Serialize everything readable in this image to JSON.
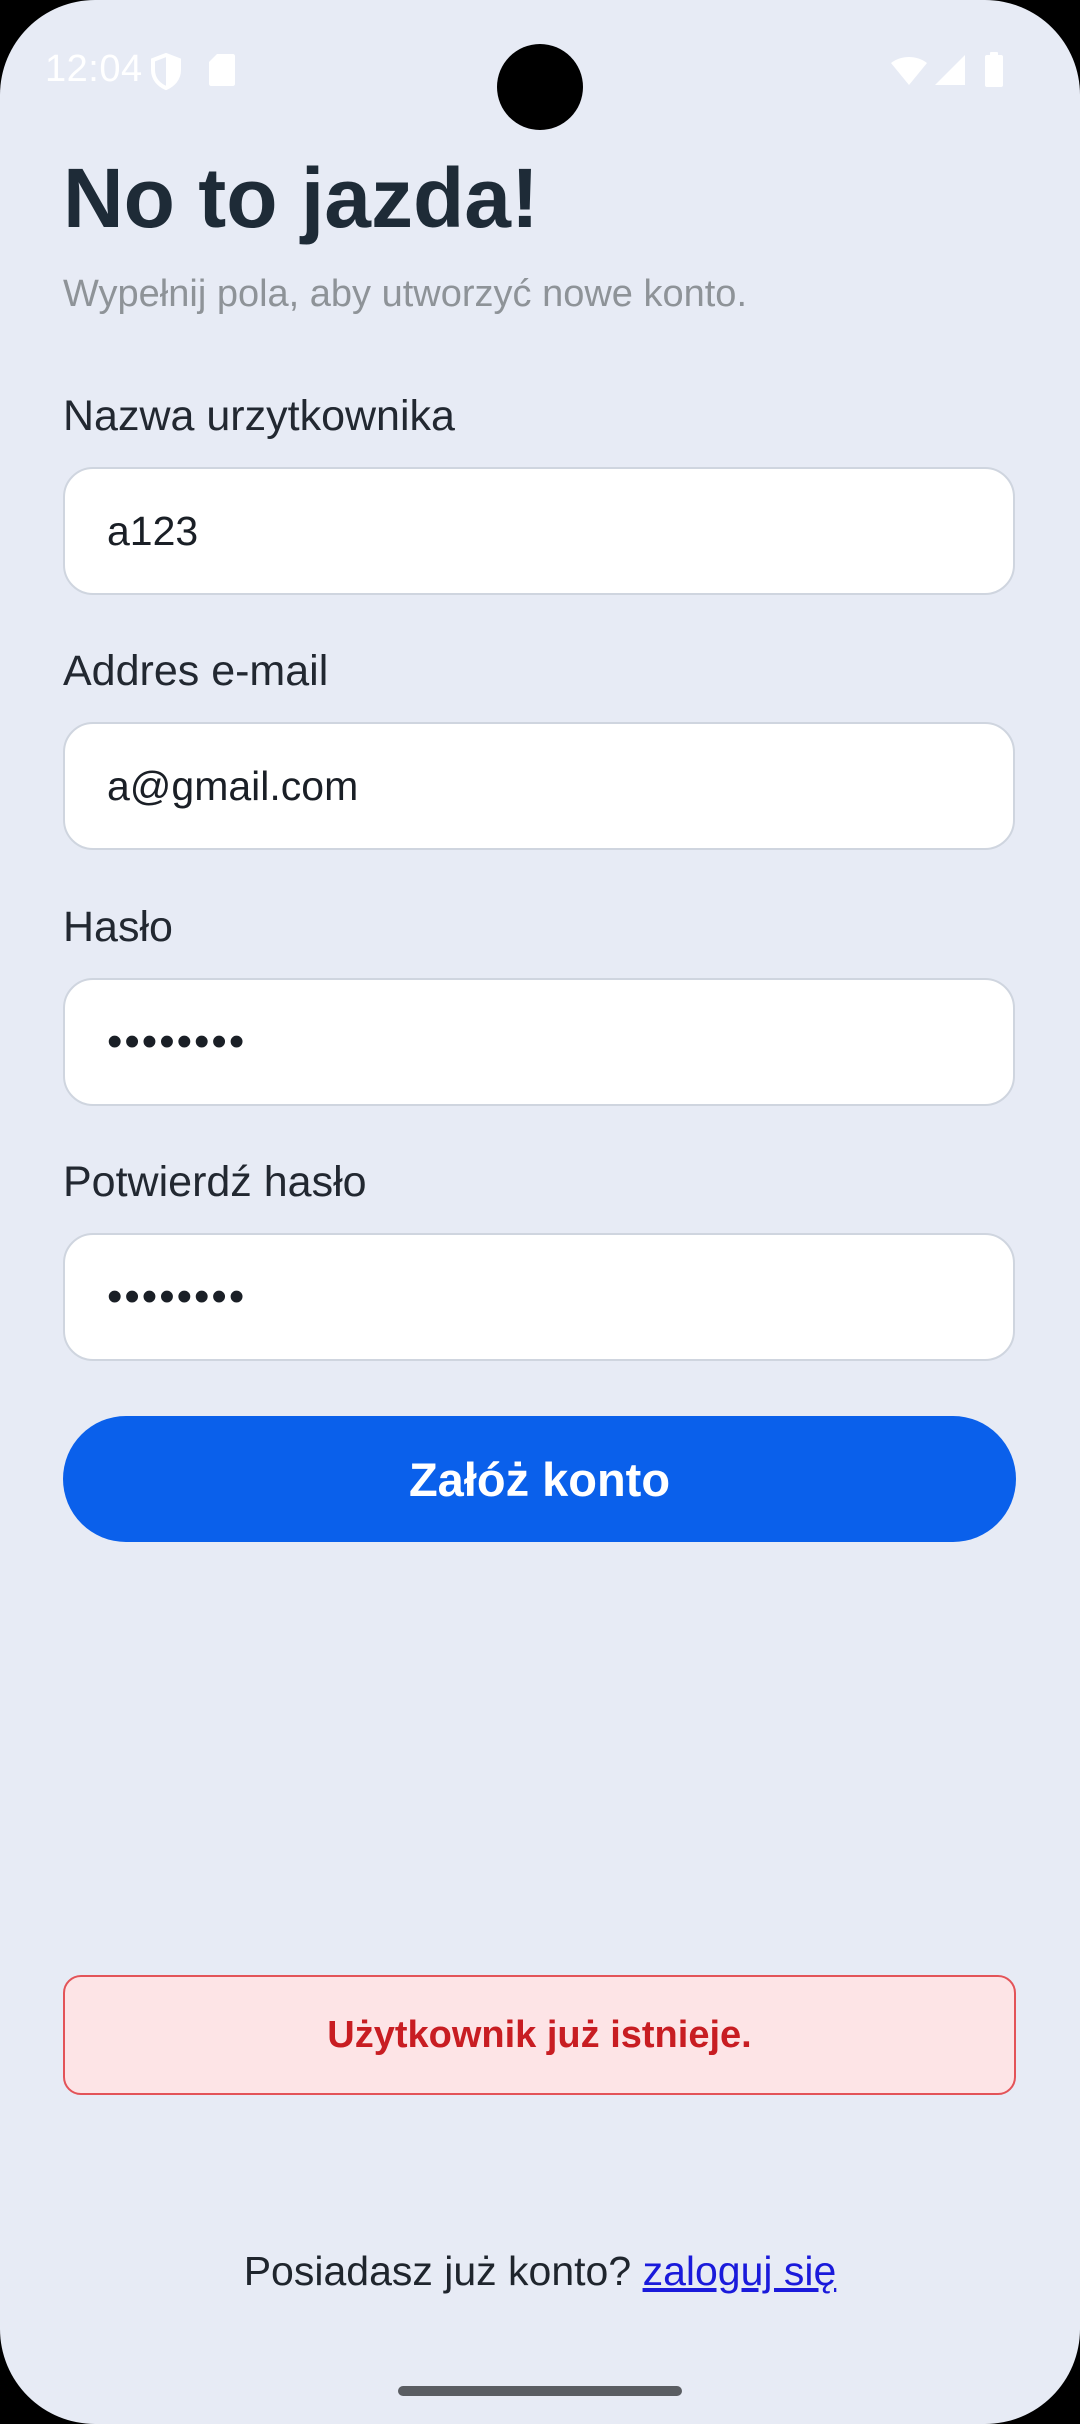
{
  "status_bar": {
    "time": "12:04",
    "icons": [
      "shield-icon",
      "sd-card-icon",
      "wifi-icon",
      "signal-icon",
      "battery-icon"
    ]
  },
  "header": {
    "title": "No to jazda!",
    "subtitle": "Wypełnij pola, aby utworzyć nowe konto."
  },
  "form": {
    "username": {
      "label": "Nazwa urzytkownika",
      "value": "a123"
    },
    "email": {
      "label": "Addres e-mail",
      "value": "a@gmail.com"
    },
    "password": {
      "label": "Hasło",
      "value": "••••••••"
    },
    "confirm_password": {
      "label": "Potwierdź hasło",
      "value": "••••••••"
    },
    "submit_label": "Załóż konto"
  },
  "error": {
    "message": "Użytkownik już istnieje."
  },
  "footer": {
    "prompt": "Posiadasz już konto? ",
    "login_link": "zaloguj się"
  },
  "colors": {
    "background": "#e7ebf5",
    "primary": "#0a60eb",
    "error_text": "#c81d22",
    "error_bg": "#fde4e6",
    "link": "#1a1adb"
  }
}
